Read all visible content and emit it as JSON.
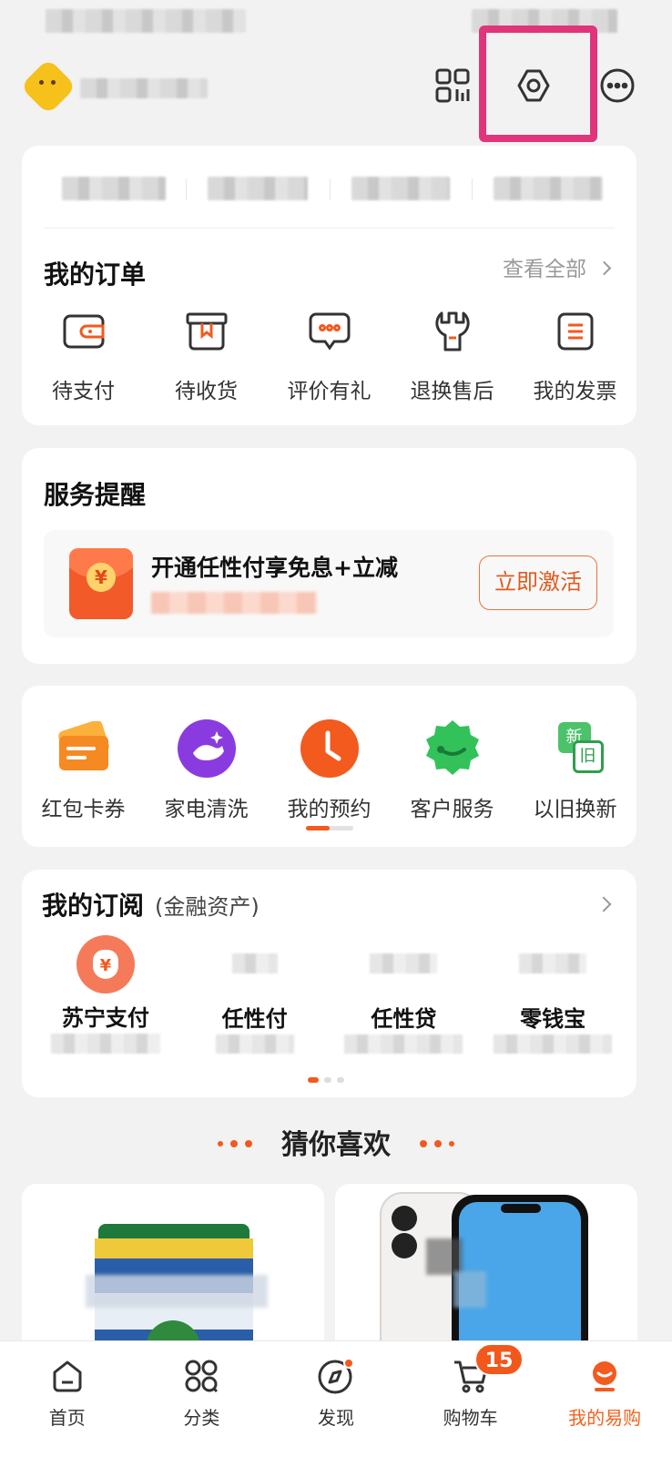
{
  "header": {
    "icons": [
      "scan-qr-icon",
      "settings-gear-icon",
      "more-chat-icon"
    ],
    "highlight_color": "#e0357a"
  },
  "orders": {
    "title": "我的订单",
    "see_all": "查看全部",
    "items": [
      {
        "label": "待支付",
        "icon": "wallet-icon"
      },
      {
        "label": "待收货",
        "icon": "box-icon"
      },
      {
        "label": "评价有礼",
        "icon": "comment-icon"
      },
      {
        "label": "退换售后",
        "icon": "wrench-icon"
      },
      {
        "label": "我的发票",
        "icon": "invoice-icon"
      }
    ]
  },
  "service": {
    "title": "服务提醒",
    "promo_title": "开通任性付享免息+立减",
    "promo_button": "立即激活",
    "envelope_symbol": "¥"
  },
  "tools": {
    "items": [
      {
        "label": "红包卡券",
        "icon": "coupon-icon"
      },
      {
        "label": "家电清洗",
        "icon": "cleaning-icon"
      },
      {
        "label": "我的预约",
        "icon": "clock-icon"
      },
      {
        "label": "客户服务",
        "icon": "customer-service-icon"
      },
      {
        "label": "以旧换新",
        "icon": "trade-in-icon"
      }
    ],
    "trade_in_new": "新",
    "trade_in_old": "旧"
  },
  "subscription": {
    "title": "我的订阅",
    "subtitle": "(金融资产)",
    "items": [
      {
        "name": "苏宁支付",
        "icon": "money-bag-icon",
        "symbol": "¥"
      },
      {
        "name": "任性付",
        "icon": "blurred-icon"
      },
      {
        "name": "任性贷",
        "icon": "blurred-icon"
      },
      {
        "name": "零钱宝",
        "icon": "blurred-icon"
      }
    ]
  },
  "guess": {
    "title": "猜你喜欢"
  },
  "tabbar": {
    "items": [
      {
        "label": "首页",
        "icon": "home-icon"
      },
      {
        "label": "分类",
        "icon": "category-icon"
      },
      {
        "label": "发现",
        "icon": "discover-icon"
      },
      {
        "label": "购物车",
        "icon": "cart-icon"
      },
      {
        "label": "我的易购",
        "icon": "my-icon"
      }
    ],
    "cart_count": "15"
  },
  "colors": {
    "accent": "#f25a1e",
    "background": "#f2f2f2"
  }
}
